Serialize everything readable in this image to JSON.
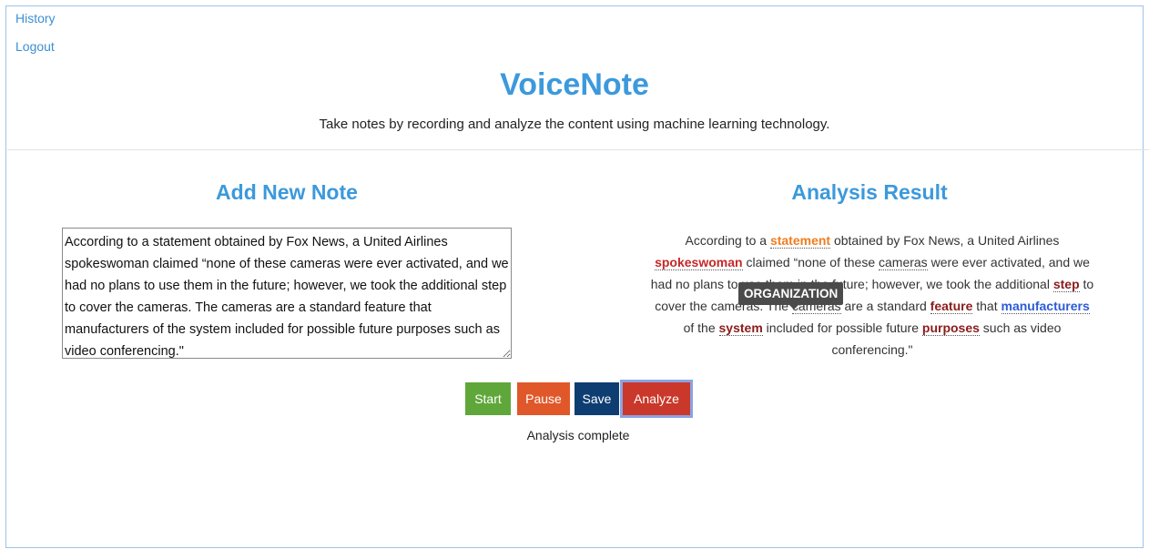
{
  "nav": {
    "history": "History",
    "logout": "Logout"
  },
  "header": {
    "title": "VoiceNote",
    "subtitle": "Take notes by recording and analyze the content using machine learning technology."
  },
  "add_note": {
    "title": "Add New Note",
    "text": "According to a statement obtained by Fox News, a United Airlines spokeswoman claimed “none of these cameras were ever activated, and we had no plans to use them in the future; however, we took the additional step to cover the cameras. The cameras are a standard feature that manufacturers of the system included for possible future purposes such as video conferencing.\""
  },
  "analysis": {
    "title": "Analysis Result",
    "tooltip": "ORGANIZATION",
    "segments": [
      {
        "text": "According to a ",
        "entity": null
      },
      {
        "text": "statement",
        "entity": "orange"
      },
      {
        "text": " obtained by Fox News, a United Airlines ",
        "entity": null
      },
      {
        "text": "spokeswoman",
        "entity": "red"
      },
      {
        "text": " claimed “none of these ",
        "entity": null
      },
      {
        "text": "cameras",
        "entity": "plain"
      },
      {
        "text": " were ever activated, and we had no plans to use them in the future; however, we took the additional ",
        "entity": null
      },
      {
        "text": "step",
        "entity": "darkred"
      },
      {
        "text": " to cover the cameras. The ",
        "entity": null
      },
      {
        "text": "cameras",
        "entity": "plain"
      },
      {
        "text": " are a standard ",
        "entity": null
      },
      {
        "text": "feature",
        "entity": "darkred"
      },
      {
        "text": " that ",
        "entity": null
      },
      {
        "text": "manufacturers",
        "entity": "blue"
      },
      {
        "text": " of the ",
        "entity": null
      },
      {
        "text": "system",
        "entity": "darkred"
      },
      {
        "text": " included for possible future ",
        "entity": null
      },
      {
        "text": "purposes",
        "entity": "darkred"
      },
      {
        "text": " such as video conferencing.\"",
        "entity": null
      }
    ]
  },
  "controls": {
    "start": "Start",
    "pause": "Pause",
    "save": "Save",
    "analyze": "Analyze"
  },
  "status": "Analysis complete",
  "colors": {
    "accent": "#3c99dc",
    "start": "#5fa73a",
    "pause": "#e0582a",
    "save": "#0e3d72",
    "analyze": "#c9382a",
    "entity_orange": "#ef7d1f",
    "entity_red": "#c62828",
    "entity_darkred": "#8a1c1c",
    "entity_blue": "#2d5bd6"
  }
}
